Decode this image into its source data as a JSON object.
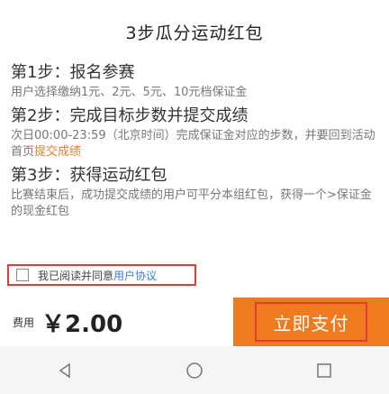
{
  "page": {
    "title": "3步瓜分运动红包"
  },
  "steps": [
    {
      "heading": "第1步：报名参赛",
      "body": "用户选择缴纳1元、2元、5元、10元档保证金"
    },
    {
      "heading": "第2步：完成目标步数并提交成绩",
      "body": "次日00:00-23:59（北京时间）完成保证金对应的步数，并要回到活动首页",
      "link": "提交成绩"
    },
    {
      "heading": "第3步：获得运动红包",
      "body": "比赛结束后，成功提交成绩的用户可平分本组红包，获得一个>保证金的现金红包"
    }
  ],
  "agreement": {
    "text": "我已阅读并同意",
    "link": "用户协议",
    "checked": false
  },
  "footer": {
    "fee_label": "费用",
    "fee_amount": "￥2.00",
    "pay_label": "立即支付"
  },
  "colors": {
    "accent": "#f07a1f",
    "highlight_border": "#e53935",
    "link_blue": "#3a7bd5"
  },
  "navbar": {
    "icons": [
      "back-icon",
      "home-icon",
      "recents-icon"
    ]
  }
}
